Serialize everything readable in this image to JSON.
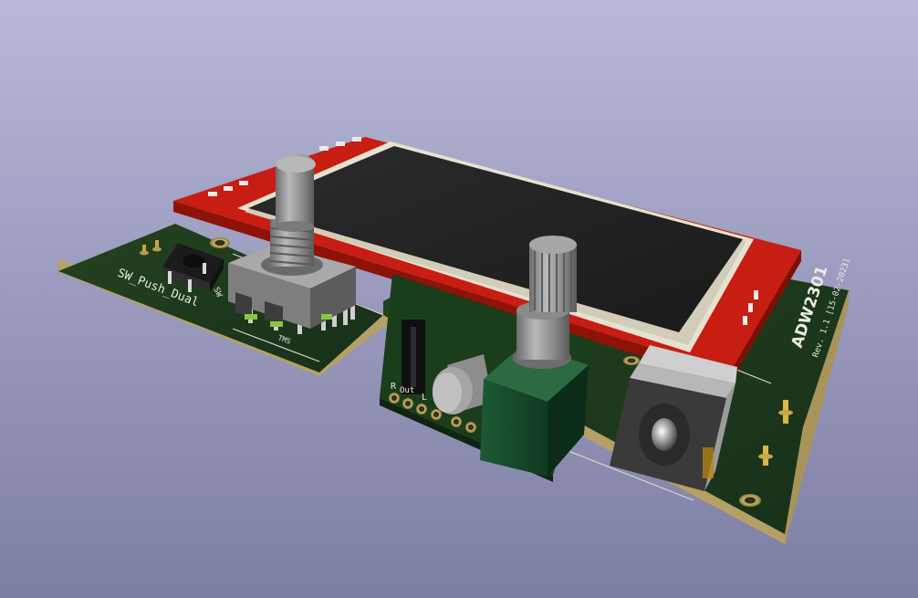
{
  "scene": {
    "title": "",
    "silkscreen": {
      "switch_label": "SW_Push_Dual",
      "switch_ref": "SW",
      "encoder_label": "TMS",
      "board_name": "ADW2301",
      "board_rev": "Rev. 1.1 [15-02-2023]",
      "audio_r": "R",
      "audio_out": "Out",
      "audio_l": "L"
    }
  },
  "colors": {
    "pcb": "#1f3b1c",
    "pcb_edge": "#bfa86a",
    "display_pcb": "#c81d12",
    "lcd_glass": "#232323",
    "lcd_bezel": "#e8e4d2",
    "knob_metal": "#a0a0a0",
    "audio_board": "#1f4a2a"
  }
}
